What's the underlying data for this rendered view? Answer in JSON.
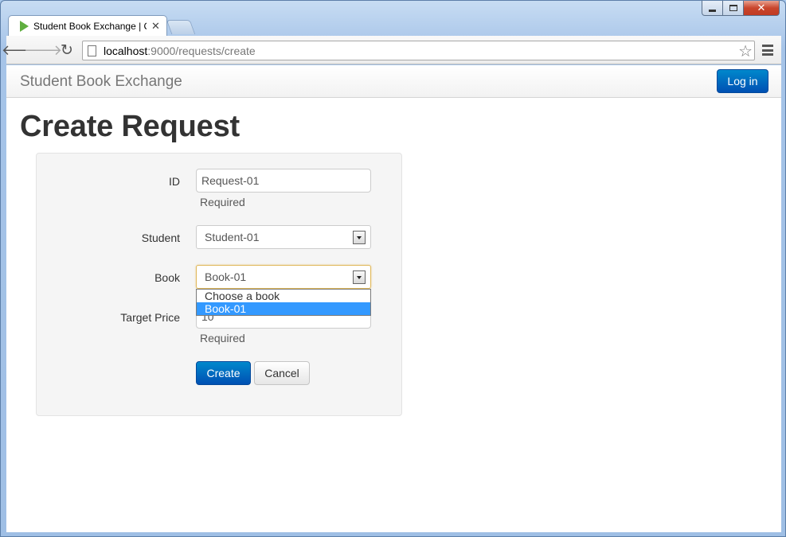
{
  "browser": {
    "tab_title": "Student Book Exchange | C",
    "url_host": "localhost",
    "url_rest": ":9000/requests/create"
  },
  "navbar": {
    "brand": "Student Book Exchange",
    "login_label": "Log in"
  },
  "page": {
    "title": "Create Request"
  },
  "form": {
    "id": {
      "label": "ID",
      "value": "Request-01",
      "help": "Required"
    },
    "student": {
      "label": "Student",
      "value": "Student-01"
    },
    "book": {
      "label": "Book",
      "value": "Book-01",
      "options": [
        "Choose a book",
        "Book-01"
      ],
      "highlighted_option": "Book-01"
    },
    "target_price": {
      "label": "Target Price",
      "value": "10",
      "help": "Required"
    },
    "create_label": "Create",
    "cancel_label": "Cancel"
  },
  "colors": {
    "primary": "#0074cc",
    "highlight": "#3399ff",
    "focus_border": "#e0b85a"
  }
}
